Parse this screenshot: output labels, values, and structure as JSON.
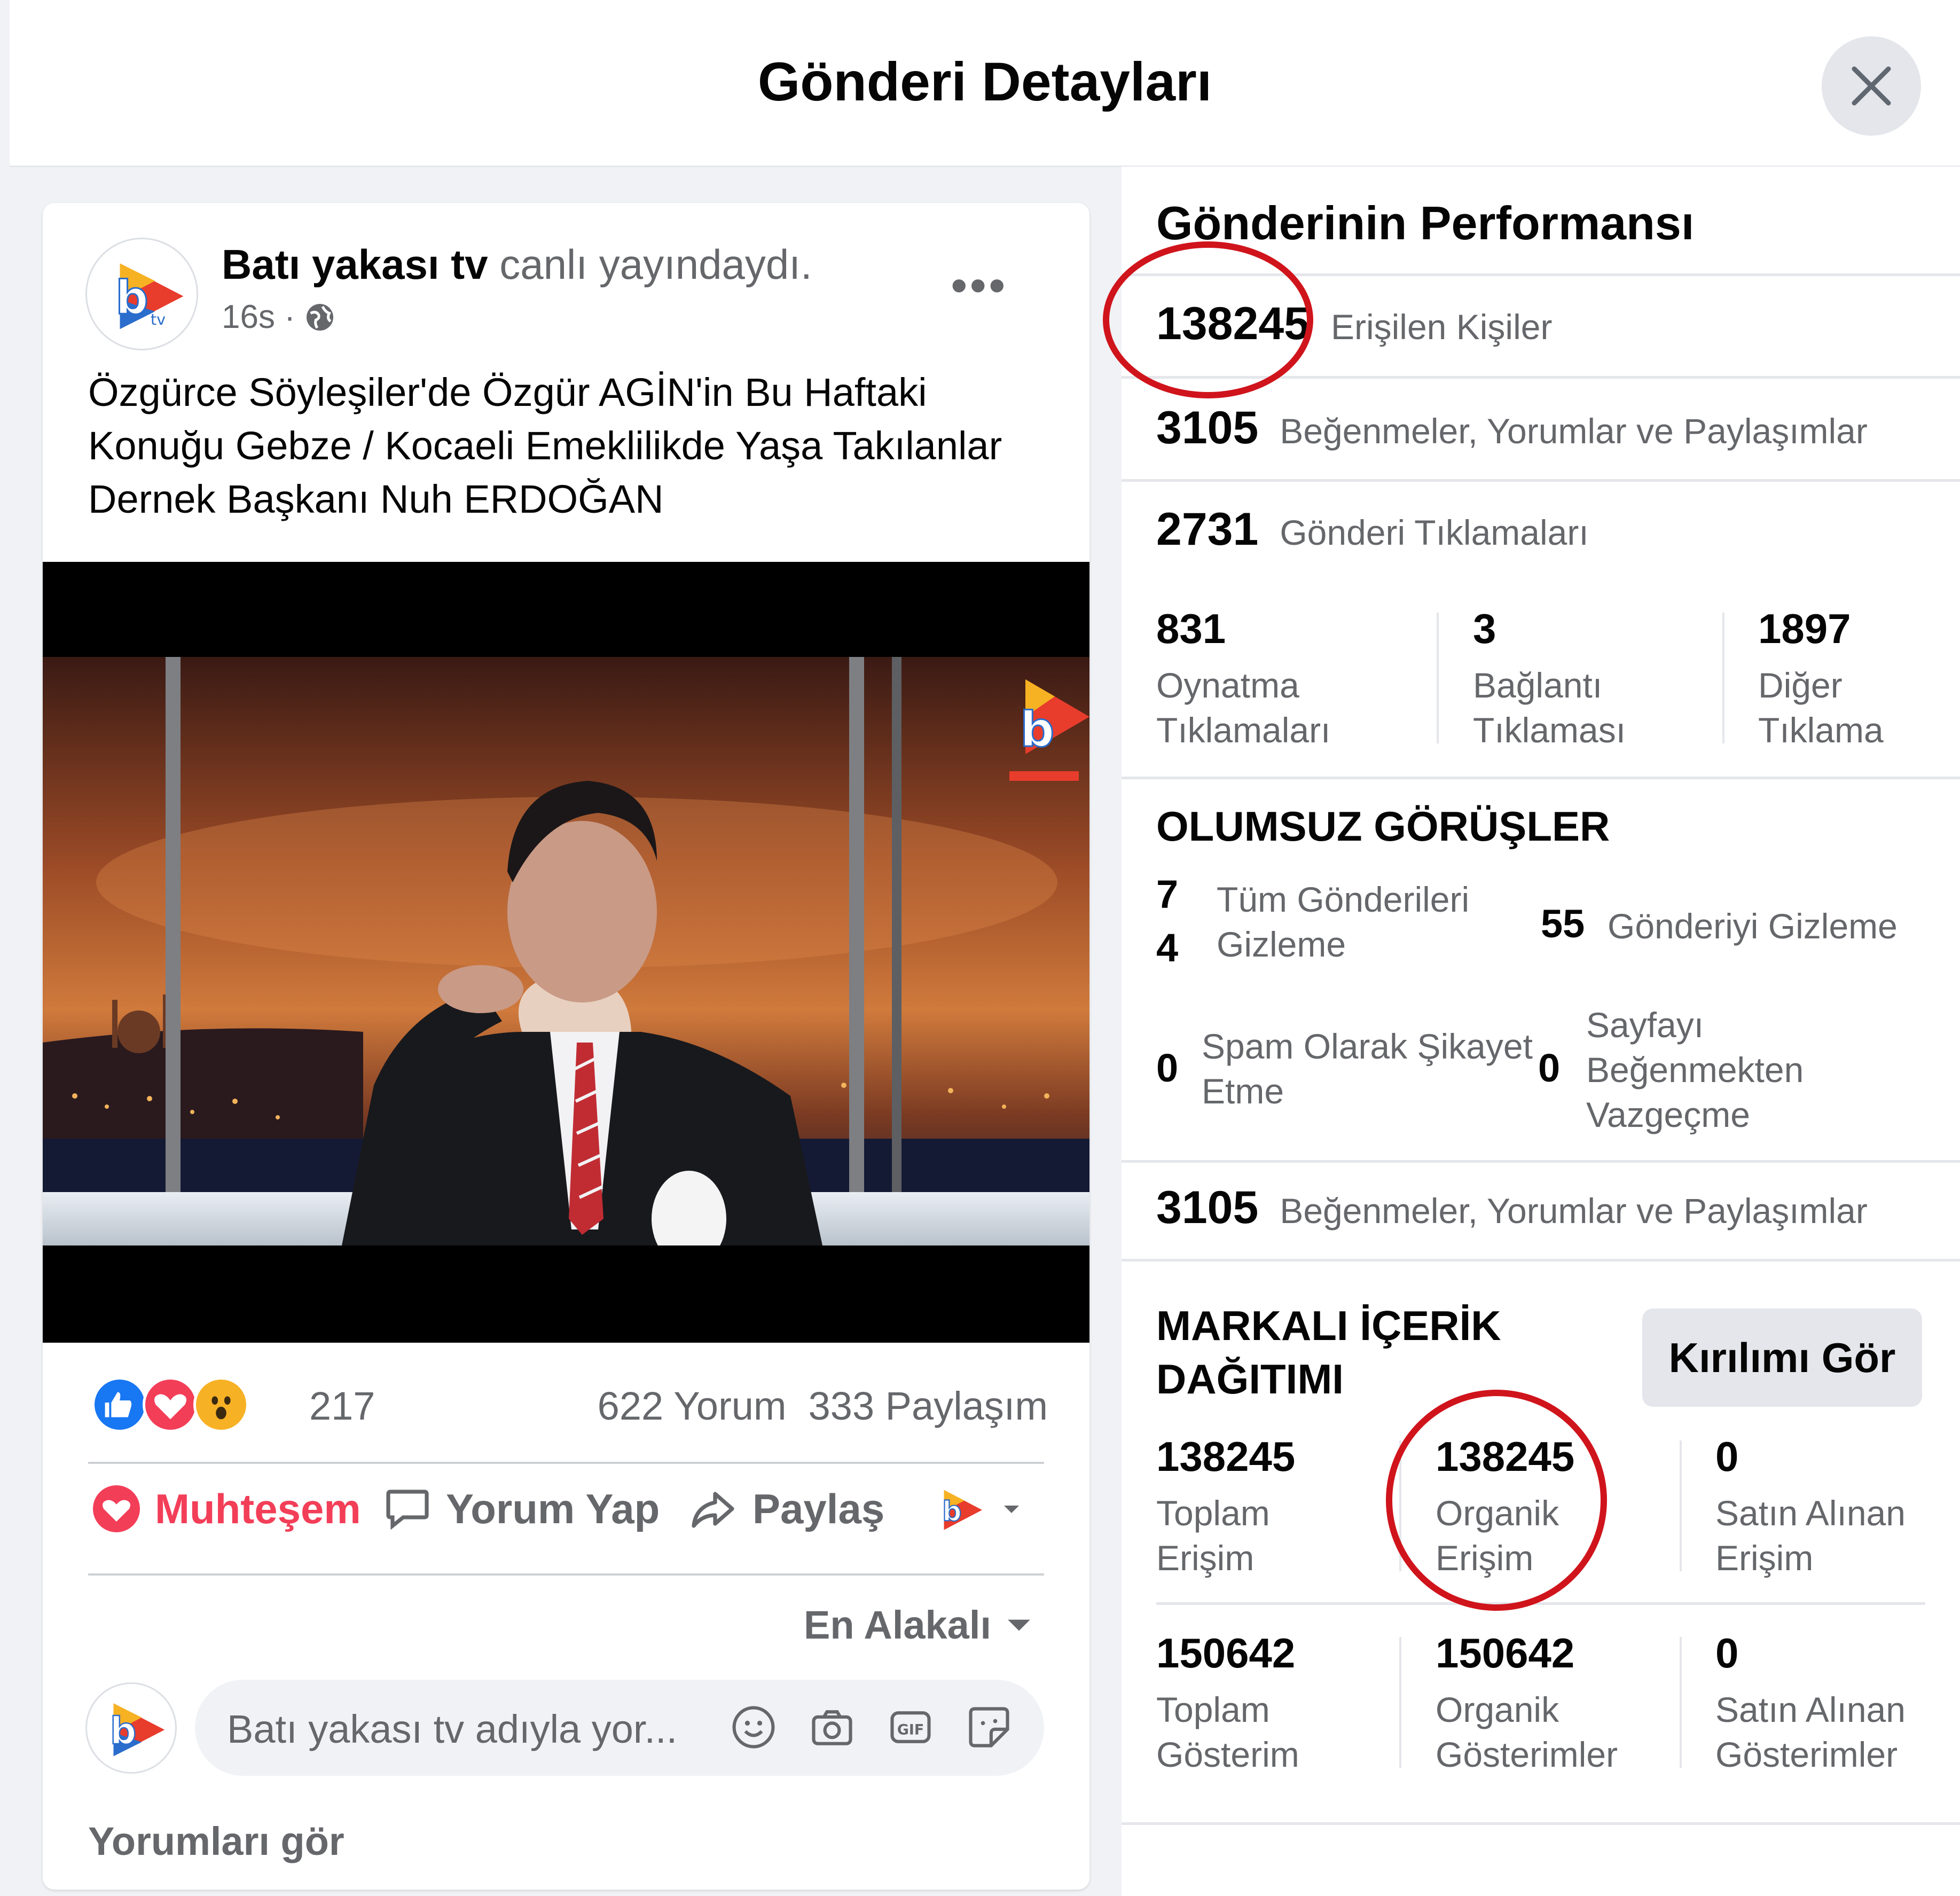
{
  "dialog": {
    "title": "Gönderi Detayları",
    "close_icon": "close-icon"
  },
  "post": {
    "page_name": "Batı yakası tv",
    "action_text": "canlı yayındaydı.",
    "time": "16s ·",
    "privacy_icon": "globe-icon",
    "text_lines": [
      "Özgürce Söyleşiler'de Özgür AGİN'in Bu Haftaki",
      "Konuğu Gebze / Kocaeli Emeklilikde Yaşa Takılanlar",
      "Dernek Başkanı Nuh ERDOĞAN"
    ],
    "reaction_count": "217",
    "comments": "622 Yorum",
    "shares": "333 Paylaşım",
    "actions": {
      "love": "Muhteşem",
      "comment": "Yorum Yap",
      "share": "Paylaş"
    },
    "sort_label": "En Alakalı",
    "comment_placeholder": "Batı yakası tv adıyla yor...",
    "see_comments": "Yorumları gör",
    "accent_love": "#f33e58",
    "accent_like": "#1877f2"
  },
  "insights": {
    "title": "Gönderinin Performansı",
    "reach": {
      "value": "138245",
      "label": "Erişilen Kişiler"
    },
    "engagement": {
      "value": "3105",
      "label": "Beğenmeler, Yorumlar ve Paylaşımlar"
    },
    "clicks": {
      "value": "2731",
      "label": "Gönderi Tıklamaları"
    },
    "click_breakdown": [
      {
        "value": "831",
        "line1": "Oynatma",
        "line2": "Tıklamaları"
      },
      {
        "value": "3",
        "line1": "Bağlantı",
        "line2": "Tıklaması"
      },
      {
        "value": "1897",
        "line1": "Diğer",
        "line2": "Tıklama"
      }
    ],
    "negative": {
      "title": "OLUMSUZ GÖRÜŞLER",
      "hide_all": {
        "value_a": "7",
        "value_b": "4",
        "line1": "Tüm Gönderileri",
        "line2": "Gizleme"
      },
      "hide_post": {
        "value": "55",
        "label": "Gönderiyi Gizleme"
      },
      "spam": {
        "value": "0",
        "line1": "Spam Olarak Şikayet",
        "line2": "Etme"
      },
      "unlike": {
        "value": "0",
        "line1": "Sayfayı",
        "line2": "Beğenmekten",
        "line3": "Vazgeçme"
      }
    },
    "engagement2": {
      "value": "3105",
      "label": "Beğenmeler, Yorumlar ve Paylaşımlar"
    },
    "branded": {
      "title_line1": "MARKALI İÇERİK",
      "title_line2": "DAĞITIMI",
      "button": "Kırılımı Gör",
      "reach_row": [
        {
          "value": "138245",
          "line1": "Toplam",
          "line2": "Erişim"
        },
        {
          "value": "138245",
          "line1": "Organik",
          "line2": "Erişim"
        },
        {
          "value": "0",
          "line1": "Satın Alınan",
          "line2": "Erişim"
        }
      ],
      "impr_row": [
        {
          "value": "150642",
          "line1": "Toplam",
          "line2": "Gösterim"
        },
        {
          "value": "150642",
          "line1": "Organik",
          "line2": "Gösterimler"
        },
        {
          "value": "0",
          "line1": "Satın Alınan",
          "line2": "Gösterimler"
        }
      ]
    },
    "annotation_color": "#d0141c"
  }
}
